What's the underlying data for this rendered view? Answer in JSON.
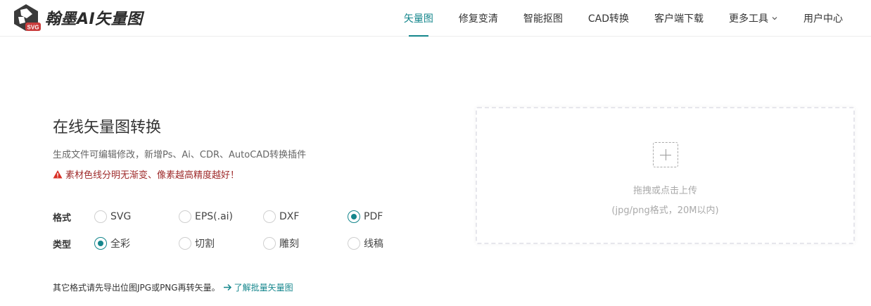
{
  "header": {
    "logo_badge": "SVG",
    "logo_text": "翰墨AI矢量图",
    "nav": [
      {
        "label": "矢量图",
        "active": true
      },
      {
        "label": "修复变清",
        "active": false
      },
      {
        "label": "智能抠图",
        "active": false
      },
      {
        "label": "CAD转换",
        "active": false
      },
      {
        "label": "客户端下载",
        "active": false
      },
      {
        "label": "更多工具",
        "active": false,
        "dropdown": true
      },
      {
        "label": "用户中心",
        "active": false
      }
    ]
  },
  "main": {
    "title": "在线矢量图转换",
    "subtitle": "生成文件可编辑修改，新增Ps、Ai、CDR、AutoCAD转换插件",
    "warning": "素材色线分明无渐变、像素越高精度越好！",
    "format": {
      "label": "格式",
      "options": [
        "SVG",
        "EPS(.ai)",
        "DXF",
        "PDF"
      ],
      "selected": "PDF"
    },
    "type": {
      "label": "类型",
      "options": [
        "全彩",
        "切割",
        "雕刻",
        "线稿"
      ],
      "selected": "全彩"
    },
    "footer_note": "其它格式请先导出位图JPG或PNG再转矢量。",
    "footer_link": "了解批量矢量图"
  },
  "upload": {
    "text": "拖拽或点击上传",
    "hint": "(jpg/png格式，20M以内)"
  },
  "colors": {
    "accent": "#14868c",
    "warning": "#d93025"
  },
  "icons": {
    "logo": "logo-icon",
    "warning": "warning-icon",
    "chevron": "chevron-down-icon",
    "arrow": "arrow-right-icon",
    "plus": "plus-icon"
  }
}
